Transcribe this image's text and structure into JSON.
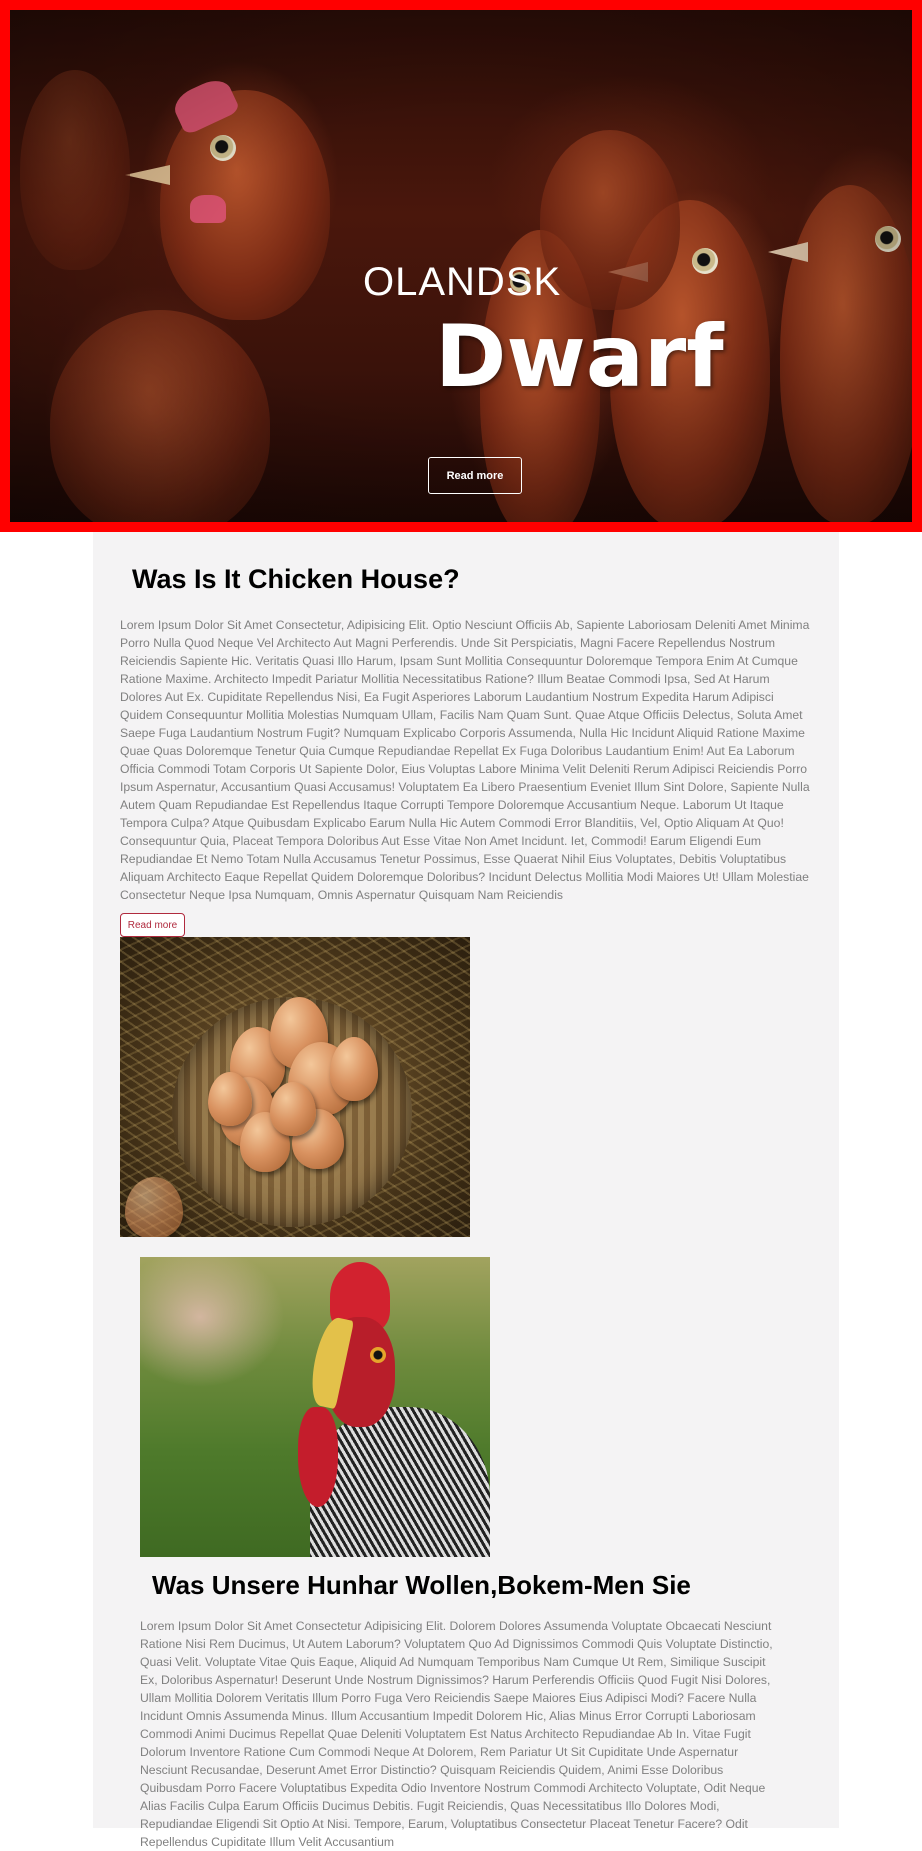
{
  "hero": {
    "subtitle": "OLANDSK",
    "title": "Dwarf",
    "button_label": "Read more",
    "border_color": "#ff0000"
  },
  "section1": {
    "heading": "Was Is It Chicken House?",
    "paragraph": "Lorem Ipsum Dolor Sit Amet Consectetur, Adipisicing Elit. Optio Nesciunt Officiis Ab, Sapiente Laboriosam Deleniti Amet Minima Porro Nulla Quod Neque Vel Architecto Aut Magni Perferendis. Unde Sit Perspiciatis, Magni Facere Repellendus Nostrum Reiciendis Sapiente Hic. Veritatis Quasi Illo Harum, Ipsam Sunt Mollitia Consequuntur Doloremque Tempora Enim At Cumque Ratione Maxime. Architecto Impedit Pariatur Mollitia Necessitatibus Ratione? Illum Beatae Commodi Ipsa, Sed At Harum Dolores Aut Ex. Cupiditate Repellendus Nisi, Ea Fugit Asperiores Laborum Laudantium Nostrum Expedita Harum Adipisci Quidem Consequuntur Mollitia Molestias Numquam Ullam, Facilis Nam Quam Sunt. Quae Atque Officiis Delectus, Soluta Amet Saepe Fuga Laudantium Nostrum Fugit? Numquam Explicabo Corporis Assumenda, Nulla Hic Incidunt Aliquid Ratione Maxime Quae Quas Doloremque Tenetur Quia Cumque Repudiandae Repellat Ex Fuga Doloribus Laudantium Enim! Aut Ea Laborum Officia Commodi Totam Corporis Ut Sapiente Dolor, Eius Voluptas Labore Minima Velit Deleniti Rerum Adipisci Reiciendis Porro Ipsum Aspernatur, Accusantium Quasi Accusamus! Voluptatem Ea Libero Praesentium Eveniet Illum Sint Dolore, Sapiente Nulla Autem Quam Repudiandae Est Repellendus Itaque Corrupti Tempore Doloremque Accusantium Neque. Laborum Ut Itaque Tempora Culpa? Atque Quibusdam Explicabo Earum Nulla Hic Autem Commodi Error Blanditiis, Vel, Optio Aliquam At Quo! Consequuntur Quia, Placeat Tempora Doloribus Aut Esse Vitae Non Amet Incidunt. Iet, Commodi! Earum Eligendi Eum Repudiandae Et Nemo Totam Nulla Accusamus Tenetur Possimus, Esse Quaerat Nihil Eius Voluptates, Debitis Voluptatibus Aliquam Architecto Eaque Repellat Quidem Doloremque Doloribus? Incidunt Delectus Mollitia Modi Maiores Ut! Ullam Molestiae Consectetur Neque Ipsa Numquam, Omnis Aspernatur Quisquam Nam Reiciendis",
    "button_label": "Read more",
    "button_color": "#b02a3e"
  },
  "section2": {
    "heading": "Was Unsere Hunhar Wollen,Bokem-Men Sie",
    "paragraph": "Lorem Ipsum Dolor Sit Amet Consectetur Adipisicing Elit. Dolorem Dolores Assumenda Voluptate Obcaecati Nesciunt Ratione Nisi Rem Ducimus, Ut Autem Laborum? Voluptatem Quo Ad Dignissimos Commodi Quis Voluptate Distinctio, Quasi Velit. Voluptate Vitae Quis Eaque, Aliquid Ad Numquam Temporibus Nam Cumque Ut Rem, Similique Suscipit Ex, Doloribus Aspernatur! Deserunt Unde Nostrum Dignissimos? Harum Perferendis Officiis Quod Fugit Nisi Dolores, Ullam Mollitia Dolorem Veritatis Illum Porro Fuga Vero Reiciendis Saepe Maiores Eius Adipisci Modi? Facere Nulla Incidunt Omnis Assumenda Minus. Illum Accusantium Impedit Dolorem Hic, Alias Minus Error Corrupti Laboriosam Commodi Animi Ducimus Repellat Quae Deleniti Voluptatem Est Natus Architecto Repudiandae Ab In. Vitae Fugit Dolorum Inventore Ratione Cum Commodi Neque At Dolorem, Rem Pariatur Ut Sit Cupiditate Unde Aspernatur Nesciunt Recusandae, Deserunt Amet Error Distinctio? Quisquam Reiciendis Quidem, Animi Esse Doloribus Quibusdam Porro Facere Voluptatibus Expedita Odio Inventore Nostrum Commodi Architecto Voluptate, Odit Neque Alias Facilis Culpa Earum Officiis Ducimus Debitis. Fugit Reiciendis, Quas Necessitatibus Illo Dolores Modi, Repudiandae Eligendi Sit Optio At Nisi. Tempore, Earum, Voluptatibus Consectetur Placeat Tenetur Facere? Odit Repellendus Cupiditate Illum Velit Accusantium"
  },
  "images": {
    "eggs_icon": "egg-basket-image",
    "rooster_icon": "rooster-image"
  },
  "colors": {
    "content_background": "#f4f3f4",
    "paragraph_text": "#808080",
    "heading_text": "#000000"
  }
}
